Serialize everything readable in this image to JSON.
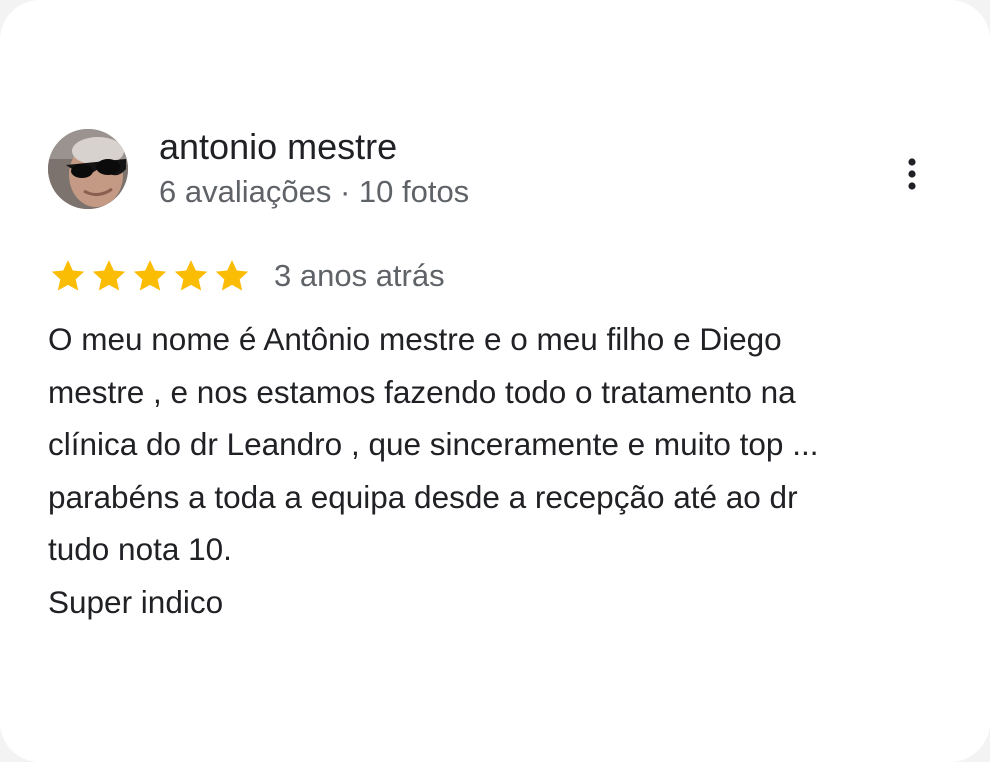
{
  "review": {
    "author": {
      "name": "antonio mestre",
      "meta": "6 avaliações · 10 fotos",
      "avatar_icon": "profile-photo"
    },
    "rating": {
      "stars": 5,
      "max": 5,
      "star_color": "#fbbc04"
    },
    "date": "3 anos atrás",
    "text": "O meu nome é Antônio mestre e o meu filho e Diego\nmestre , e nos estamos fazendo todo o tratamento na\nclínica do dr Leandro , que sinceramente e muito top ...\nparabéns a toda a equipa desde a recepção até ao dr\ntudo nota 10.\nSuper indico",
    "menu_icon": "more-vert-icon"
  }
}
